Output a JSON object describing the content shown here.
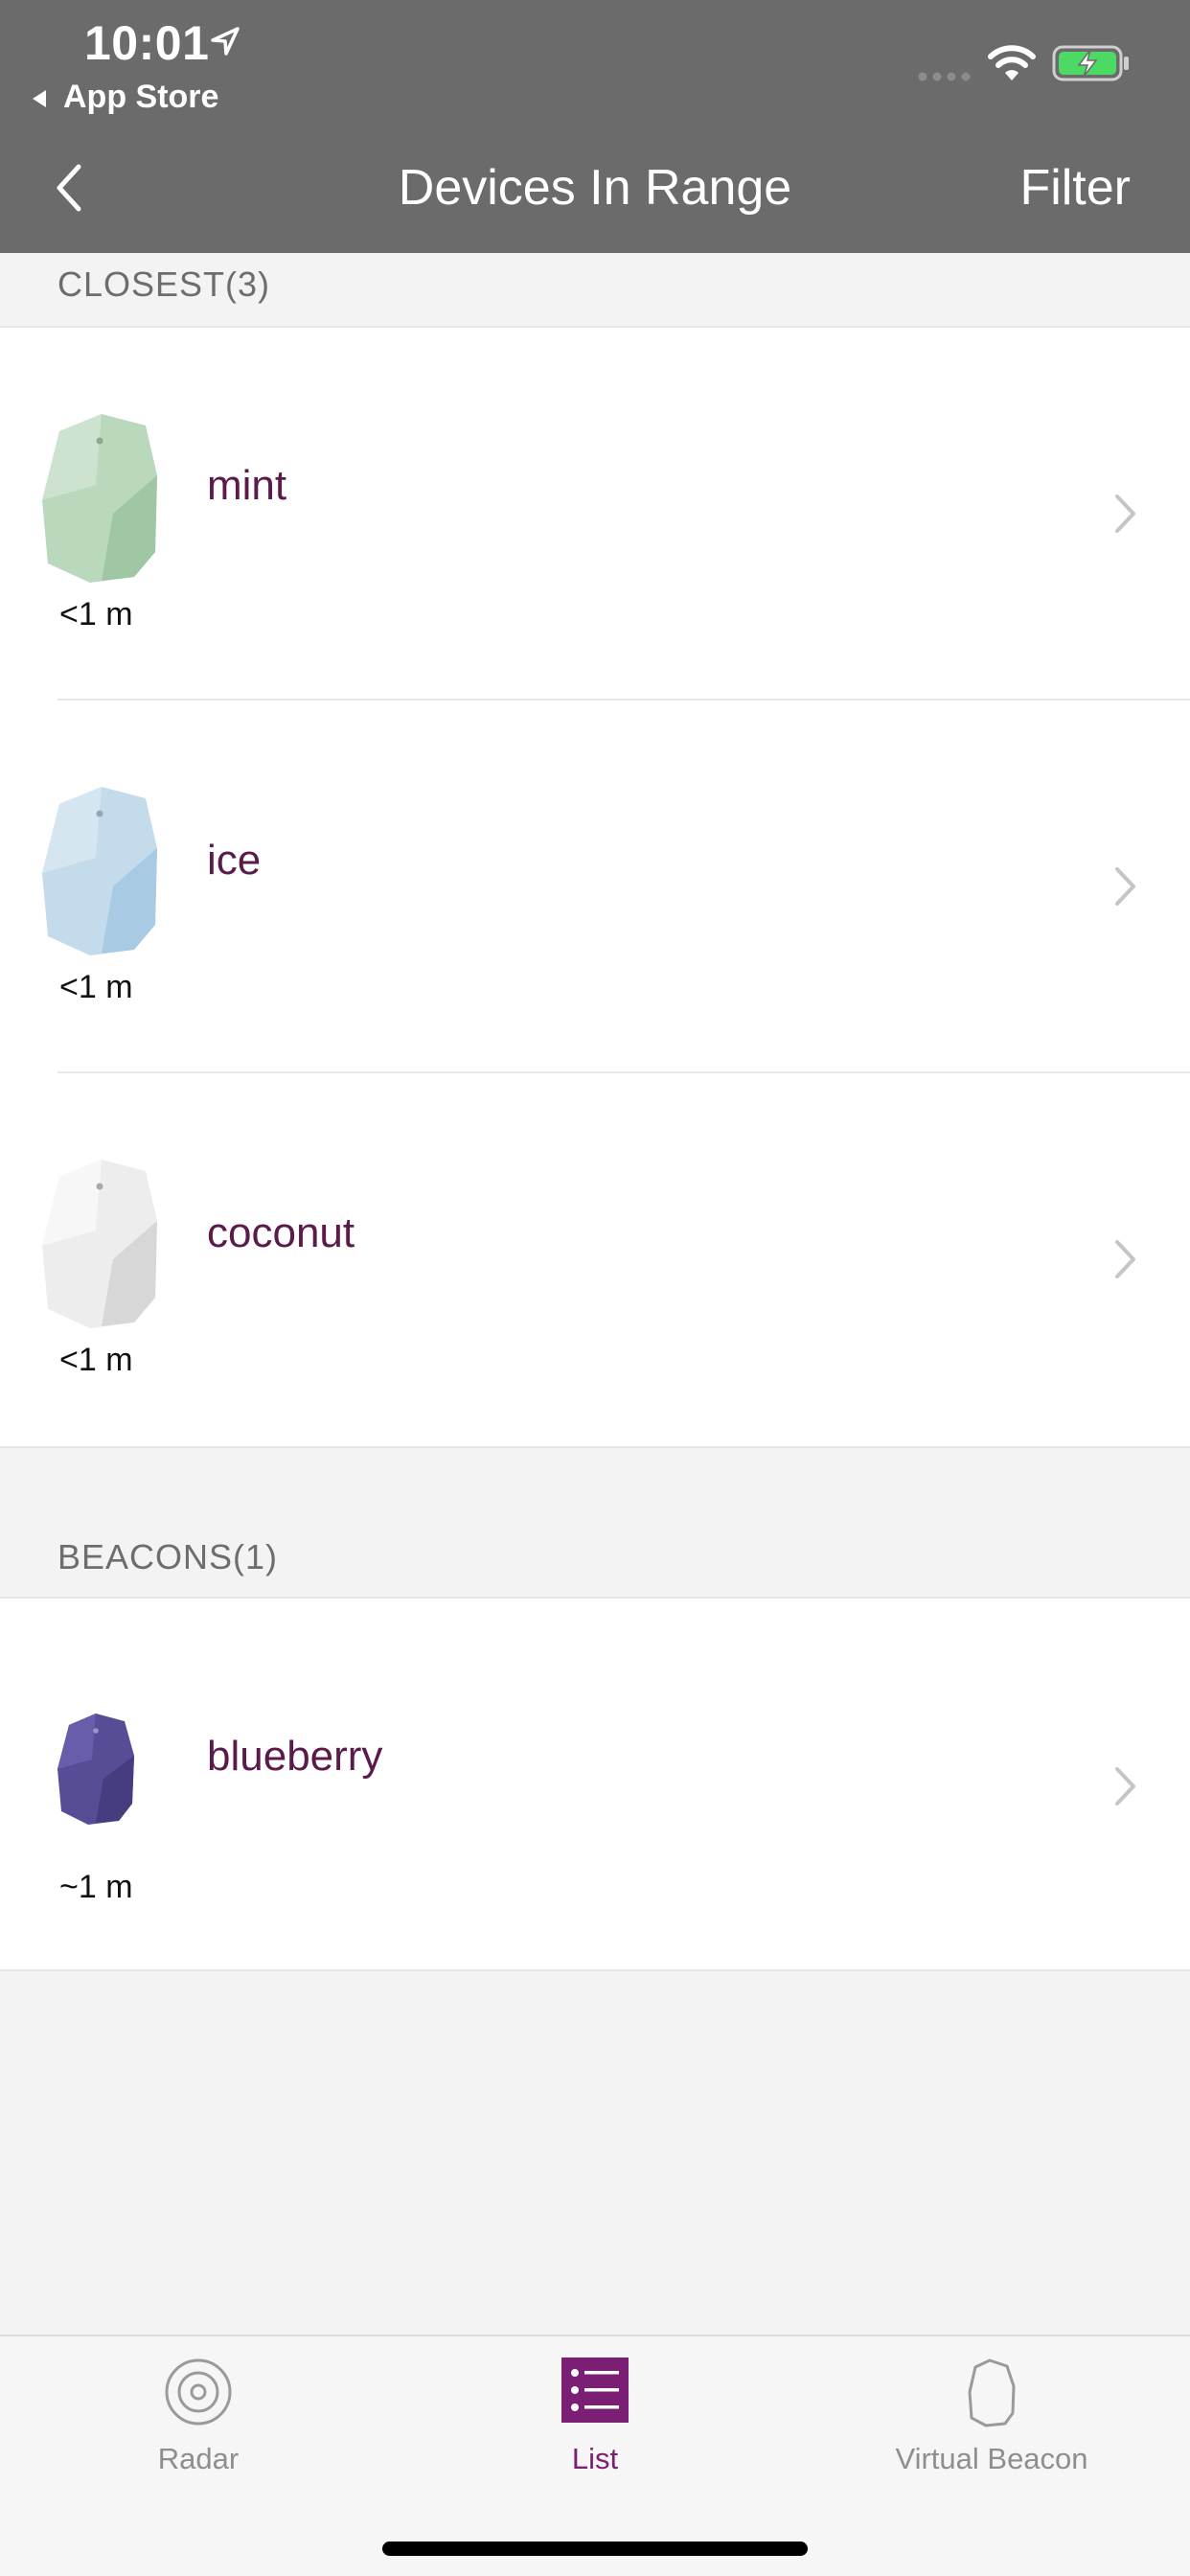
{
  "status_bar": {
    "time": "10:01",
    "back_app": "App Store",
    "icons": [
      "location-arrow-icon",
      "signal-icon",
      "wifi-icon",
      "battery-charging-icon"
    ]
  },
  "nav": {
    "title": "Devices In Range",
    "filter_label": "Filter",
    "back_icon": "chevron-left-icon"
  },
  "sections": [
    {
      "header": "CLOSEST(3)",
      "devices": [
        {
          "name": "mint",
          "distance": "<1 m",
          "color": "#b9d8bc",
          "shade": "#9fc7a3"
        },
        {
          "name": "ice",
          "distance": "<1 m",
          "color": "#c3dbeb",
          "shade": "#a8cae2"
        },
        {
          "name": "coconut",
          "distance": "<1 m",
          "color": "#efefef",
          "shade": "#d9d9d9"
        }
      ]
    },
    {
      "header": "BEACONS(1)",
      "devices": [
        {
          "name": "blueberry",
          "distance": "~1 m",
          "color": "#574c96",
          "shade": "#463c80"
        }
      ]
    }
  ],
  "tab_bar": {
    "tabs": [
      {
        "label": "Radar",
        "icon": "radar-icon",
        "active": false
      },
      {
        "label": "List",
        "icon": "list-icon",
        "active": true
      },
      {
        "label": "Virtual Beacon",
        "icon": "beacon-outline-icon",
        "active": false
      }
    ]
  },
  "colors": {
    "header_bg": "#6b6b6b",
    "accent": "#7b1f74",
    "device_name": "#5a1a4a"
  }
}
